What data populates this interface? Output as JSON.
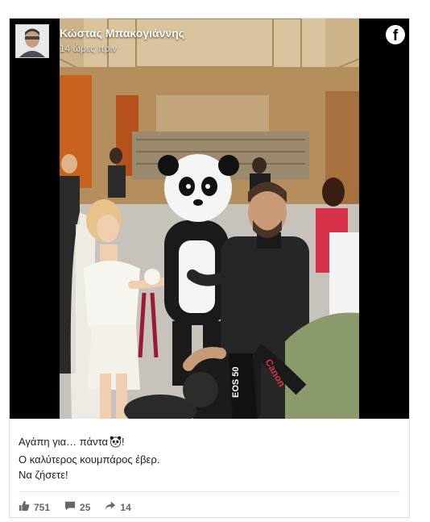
{
  "post": {
    "author": "Κώστας Μπακογιάννης",
    "time": "14 ώρες πριν",
    "caption_lines": [
      "Αγάπη για… πάντα",
      "Ο καλύτερος κουμπάρος έβερ.",
      "Να ζήσετε!"
    ],
    "caption_emoji": "panda",
    "photo_camera_text": [
      "EOS 50",
      "Canon"
    ]
  },
  "reactions": {
    "likes": "751",
    "comments": "25",
    "shares": "14"
  },
  "icons": [
    "facebook-logo-icon",
    "like-icon",
    "comment-icon",
    "share-icon"
  ],
  "colors": {
    "page_bg": "#ffffff",
    "media_bg": "#000000",
    "text": "#1c1e21",
    "muted": "#65676b",
    "border": "#dddfe2"
  }
}
